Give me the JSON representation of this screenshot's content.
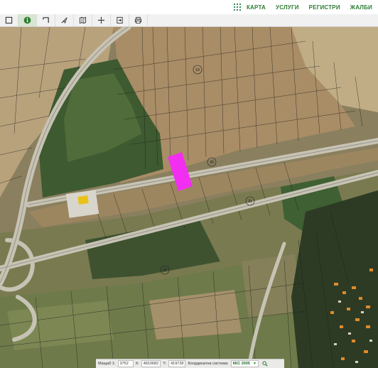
{
  "nav": {
    "items": [
      {
        "label": "КАРТА"
      },
      {
        "label": "УСЛУГИ"
      },
      {
        "label": "РЕГИСТРИ"
      },
      {
        "label": "ЖАЛБИ"
      }
    ]
  },
  "toolbar": {
    "tools": [
      {
        "icon": "rectangle-select-icon"
      },
      {
        "icon": "info-icon",
        "active": true
      },
      {
        "icon": "measure-angle-icon"
      },
      {
        "icon": "pointer-icon"
      },
      {
        "icon": "map-book-icon"
      },
      {
        "icon": "move-icon"
      },
      {
        "icon": "export-icon"
      },
      {
        "icon": "print-icon"
      }
    ]
  },
  "map": {
    "parcel_labels": [
      "19",
      "20",
      "21",
      "22"
    ],
    "highlight_color": "#f22ff0",
    "highlight_label": "selected-parcel"
  },
  "statusbar": {
    "scale_label": "Мащаб 1:",
    "scale_value": "3752",
    "x_label": "X:",
    "x_value": "4810682",
    "y_label": "Y:",
    "y_value": "419728",
    "crs_label": "Координатна система:",
    "crs_value": "ККС 2005"
  }
}
